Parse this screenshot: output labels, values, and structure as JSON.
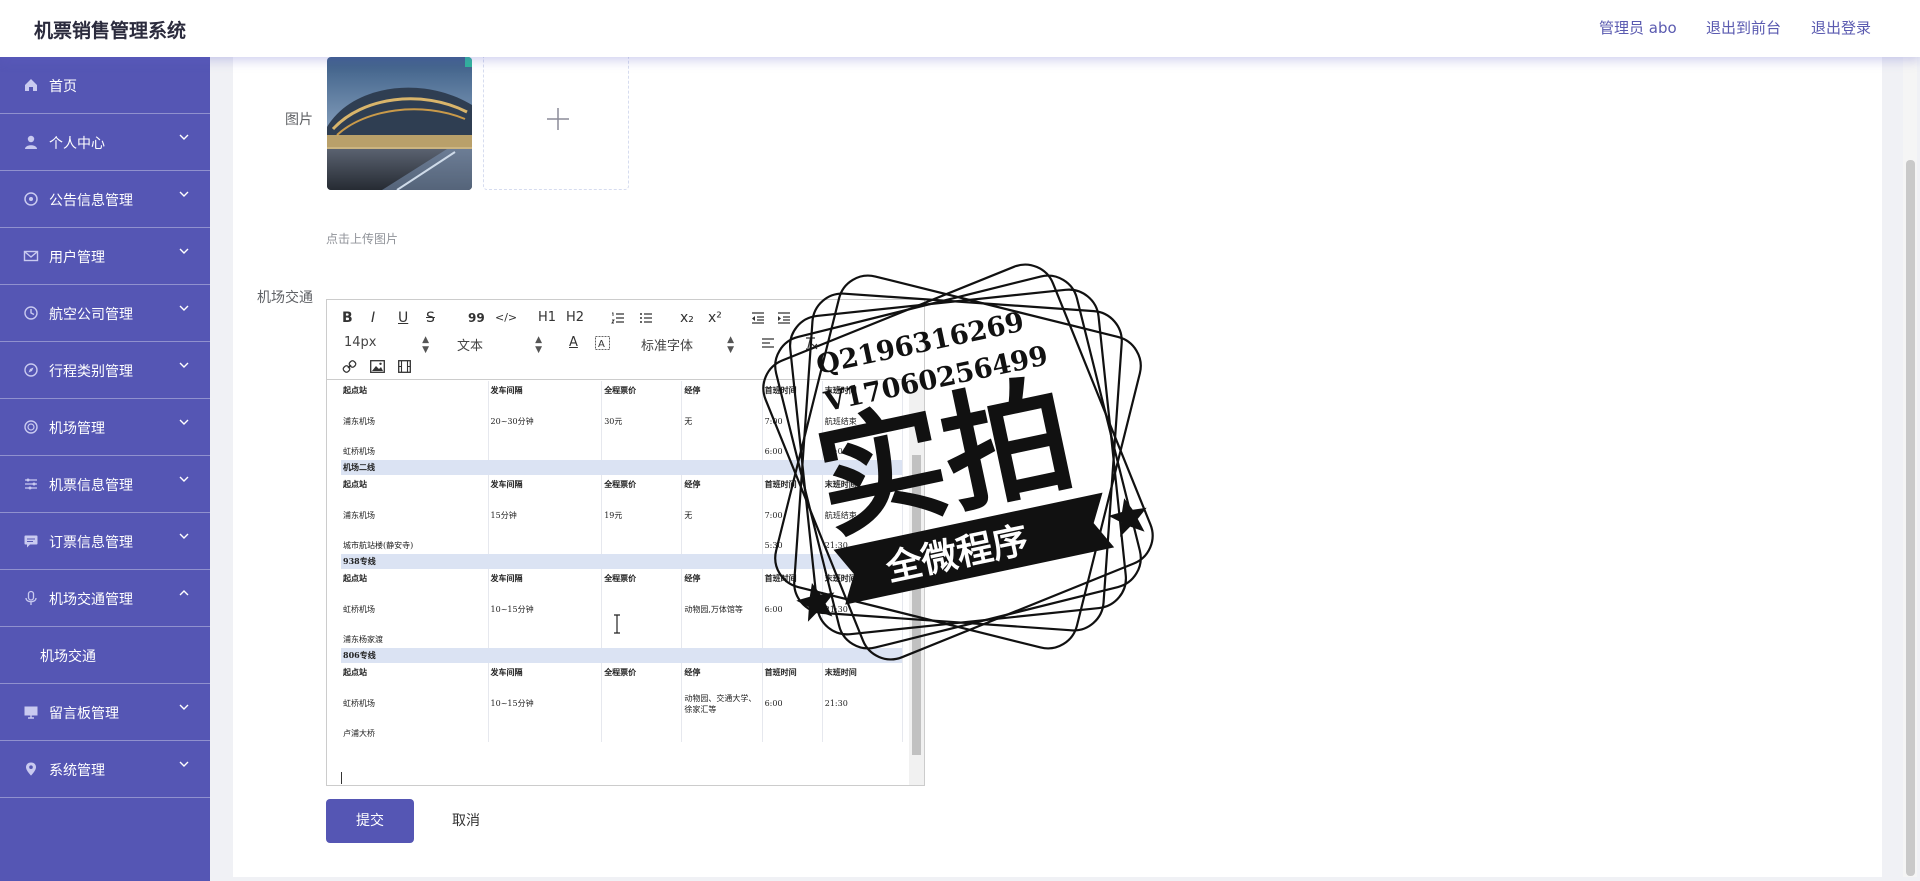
{
  "app": {
    "title": "机票销售管理系统"
  },
  "header": {
    "user": "管理员 abo",
    "front": "退出到前台",
    "logout": "退出登录"
  },
  "sidebar": {
    "items": [
      {
        "label": "首页",
        "icon": "home-icon"
      },
      {
        "label": "个人中心",
        "icon": "user-icon"
      },
      {
        "label": "公告信息管理",
        "icon": "target-icon"
      },
      {
        "label": "用户管理",
        "icon": "mail-icon"
      },
      {
        "label": "航空公司管理",
        "icon": "clock-icon"
      },
      {
        "label": "行程类别管理",
        "icon": "compass-icon"
      },
      {
        "label": "机场管理",
        "icon": "globe-icon"
      },
      {
        "label": "机票信息管理",
        "icon": "sliders-icon"
      },
      {
        "label": "订票信息管理",
        "icon": "chat-icon"
      },
      {
        "label": "机场交通管理",
        "icon": "mic-icon"
      },
      {
        "label": "留言板管理",
        "icon": "monitor-icon"
      },
      {
        "label": "系统管理",
        "icon": "location-icon"
      }
    ],
    "sub_item": "机场交通"
  },
  "form": {
    "image_label": "图片",
    "upload_tip": "点击上传图片",
    "traffic_label": "机场交通",
    "submit": "提交",
    "cancel": "取消"
  },
  "editor": {
    "toolbar": {
      "bold": "B",
      "italic": "I",
      "underline": "U",
      "strike": "S",
      "quote": "99",
      "code": "</>",
      "h1": "H1",
      "h2": "H2",
      "sub": "x₂",
      "sup": "x²",
      "size": "14px",
      "block": "文本",
      "font": "标准字体"
    },
    "table": {
      "rows": [
        {
          "kind": "head",
          "cells": [
            "起点站",
            "发车间隔",
            "全程票价",
            "经停",
            "首班时间",
            "末班时间"
          ]
        },
        {
          "kind": "mid",
          "cells": [
            "浦东机场",
            "20~30分钟",
            "30元",
            "无",
            "7:00",
            "航班结束"
          ]
        },
        {
          "kind": "low",
          "cells": [
            "虹桥机场",
            "",
            "",
            "",
            "6:00",
            "23:00"
          ]
        },
        {
          "kind": "band",
          "cells": [
            "机场二线"
          ]
        },
        {
          "kind": "head",
          "cells": [
            "起点站",
            "发车间隔",
            "全程票价",
            "经停",
            "首班时间",
            "末班时间"
          ]
        },
        {
          "kind": "mid",
          "cells": [
            "浦东机场",
            "15分钟",
            "19元",
            "无",
            "7:00",
            "航班结束"
          ]
        },
        {
          "kind": "low",
          "cells": [
            "城市航站楼(静安寺)",
            "",
            "",
            "",
            "5:30",
            "21:30"
          ]
        },
        {
          "kind": "band",
          "cells": [
            "938专线"
          ]
        },
        {
          "kind": "head",
          "cells": [
            "起点站",
            "发车间隔",
            "全程票价",
            "经停",
            "首班时间",
            "末班时间"
          ]
        },
        {
          "kind": "mid",
          "cells": [
            "虹桥机场",
            "10~15分钟",
            "",
            "动物园,万体馆等",
            "6:00",
            "21:30"
          ]
        },
        {
          "kind": "low",
          "cells": [
            "浦东杨家渡",
            "",
            "",
            "",
            "",
            ""
          ]
        },
        {
          "kind": "band",
          "cells": [
            "806专线"
          ]
        },
        {
          "kind": "head",
          "cells": [
            "起点站",
            "发车间隔",
            "全程票价",
            "经停",
            "首班时间",
            "末班时间"
          ]
        },
        {
          "kind": "mid",
          "cells": [
            "虹桥机场",
            "10~15分钟",
            "",
            "动物园、交通大学、徐家汇等",
            "6:00",
            "21:30"
          ]
        },
        {
          "kind": "low",
          "cells": [
            "卢浦大桥",
            "",
            "",
            "",
            "",
            ""
          ]
        }
      ]
    }
  },
  "watermark": {
    "qq": "Q2196316269",
    "vx": "V17060256499",
    "big": "实拍",
    "banner": "全微程序"
  },
  "colors": {
    "primary": "#5556b4",
    "band": "#dbe3f3"
  }
}
